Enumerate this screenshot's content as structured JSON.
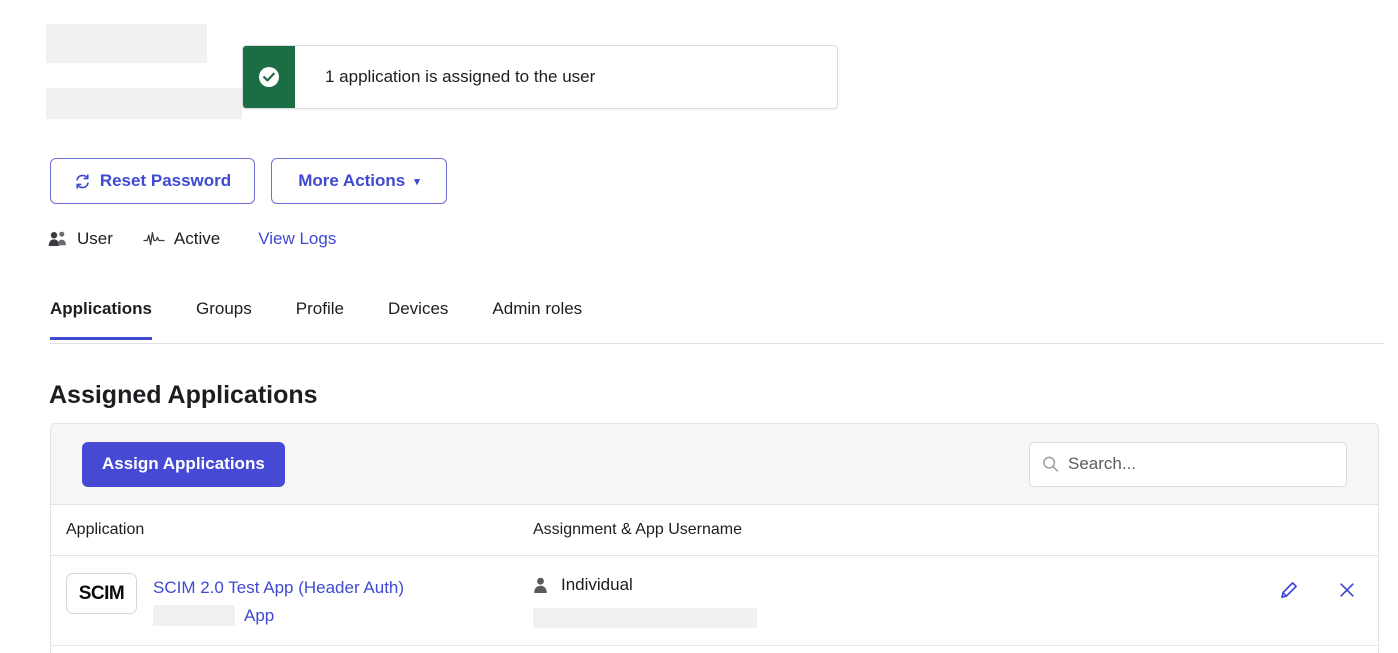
{
  "banner": {
    "icon": "check-circle-icon",
    "message": "1 application is assigned to the user",
    "accent_color": "#1b6e43"
  },
  "actions": {
    "reset_password": "Reset Password",
    "reset_password_icon": "refresh-icon",
    "more_actions": "More Actions",
    "more_actions_caret": "▾"
  },
  "meta": {
    "user_type_icon": "group-user-icon",
    "user_type": "User",
    "status_icon": "activity-pulse-icon",
    "status": "Active",
    "view_logs": "View Logs"
  },
  "tabs": [
    {
      "label": "Applications",
      "active": true
    },
    {
      "label": "Groups",
      "active": false
    },
    {
      "label": "Profile",
      "active": false
    },
    {
      "label": "Devices",
      "active": false
    },
    {
      "label": "Admin roles",
      "active": false
    }
  ],
  "section": {
    "title": "Assigned Applications"
  },
  "toolbar": {
    "assign_button": "Assign Applications",
    "search_placeholder": "Search...",
    "search_value": "",
    "search_icon": "search-icon"
  },
  "table": {
    "columns": {
      "application": "Application",
      "assignment": "Assignment & App Username",
      "actions": ""
    },
    "rows": [
      {
        "logo_text": "SCIM",
        "app_name": "SCIM 2.0 Test App (Header Auth)",
        "app_name_second_line": "App",
        "assignment_icon": "person-icon",
        "assignment": "Individual",
        "app_username": "",
        "edit_icon": "pencil-icon",
        "remove_icon": "close-x-icon"
      }
    ]
  },
  "colors": {
    "primary": "#4549d4",
    "link": "#3f4ad1",
    "success": "#1b6e43",
    "toolbar_bg": "#f6f6f6",
    "redact": "#f1f1f1"
  }
}
